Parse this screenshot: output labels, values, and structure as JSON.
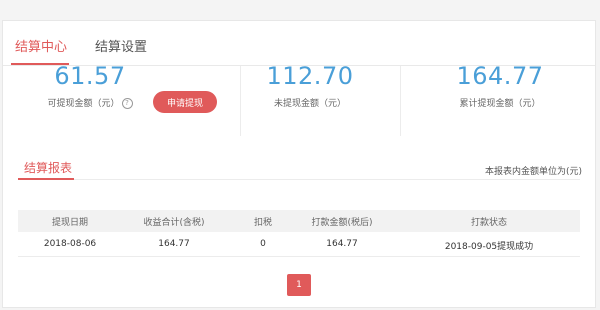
{
  "tabs": [
    {
      "label": "结算中心",
      "active": true
    },
    {
      "label": "结算设置",
      "active": false
    }
  ],
  "stats": [
    {
      "value": "61.57",
      "label": "可提现金额（元）"
    },
    {
      "value": "112.70",
      "label": "未提现金额（元）"
    },
    {
      "value": "164.77",
      "label": "累计提现金额（元）"
    }
  ],
  "withdraw_button": "申请提现",
  "help_icon": "question-circle-icon",
  "report": {
    "title": "结算报表",
    "unit_note": "本报表内金额单位为(元)"
  },
  "table": {
    "headers": [
      "提现日期",
      "收益合计(含税)",
      "扣税",
      "打款金额(税后)",
      "打款状态"
    ],
    "rows": [
      [
        "2018-08-06",
        "164.77",
        "0",
        "164.77",
        "2018-09-05提现成功"
      ]
    ]
  },
  "pagination": {
    "current": "1"
  },
  "colors": {
    "accent": "#e05a5a",
    "value_blue": "#4a9fd8"
  }
}
